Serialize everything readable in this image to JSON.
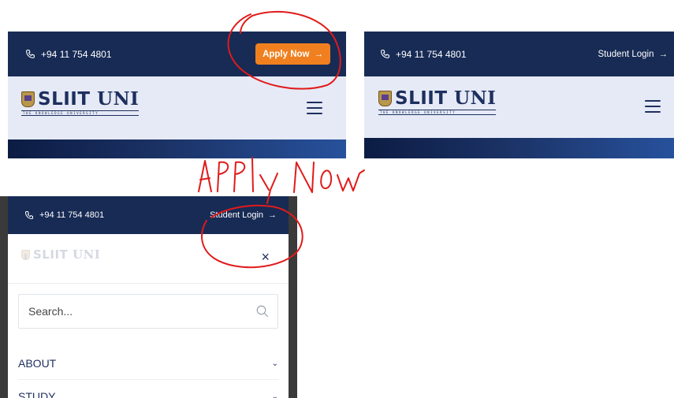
{
  "topbar": {
    "phone": "+94 11 754 4801",
    "apply_label": "Apply Now",
    "login_label": "Student Login",
    "arrow": "→"
  },
  "logo": {
    "brand_main": "SLIIT",
    "brand_uni": "UNI",
    "tagline": "THE KNOWLEDGE UNIVERSITY"
  },
  "menu": {
    "close": "×",
    "search_placeholder": "Search...",
    "items": [
      {
        "label": "ABOUT",
        "chevron": "⌄"
      },
      {
        "label": "STUDY",
        "chevron": "⌄"
      }
    ]
  },
  "annotation": {
    "handwritten_text": "Apply Now",
    "color": "#e01b1b"
  },
  "colors": {
    "topbar": "#172b55",
    "header": "#e6eaf6",
    "accent": "#f0801f",
    "brand": "#1d2f5e"
  }
}
